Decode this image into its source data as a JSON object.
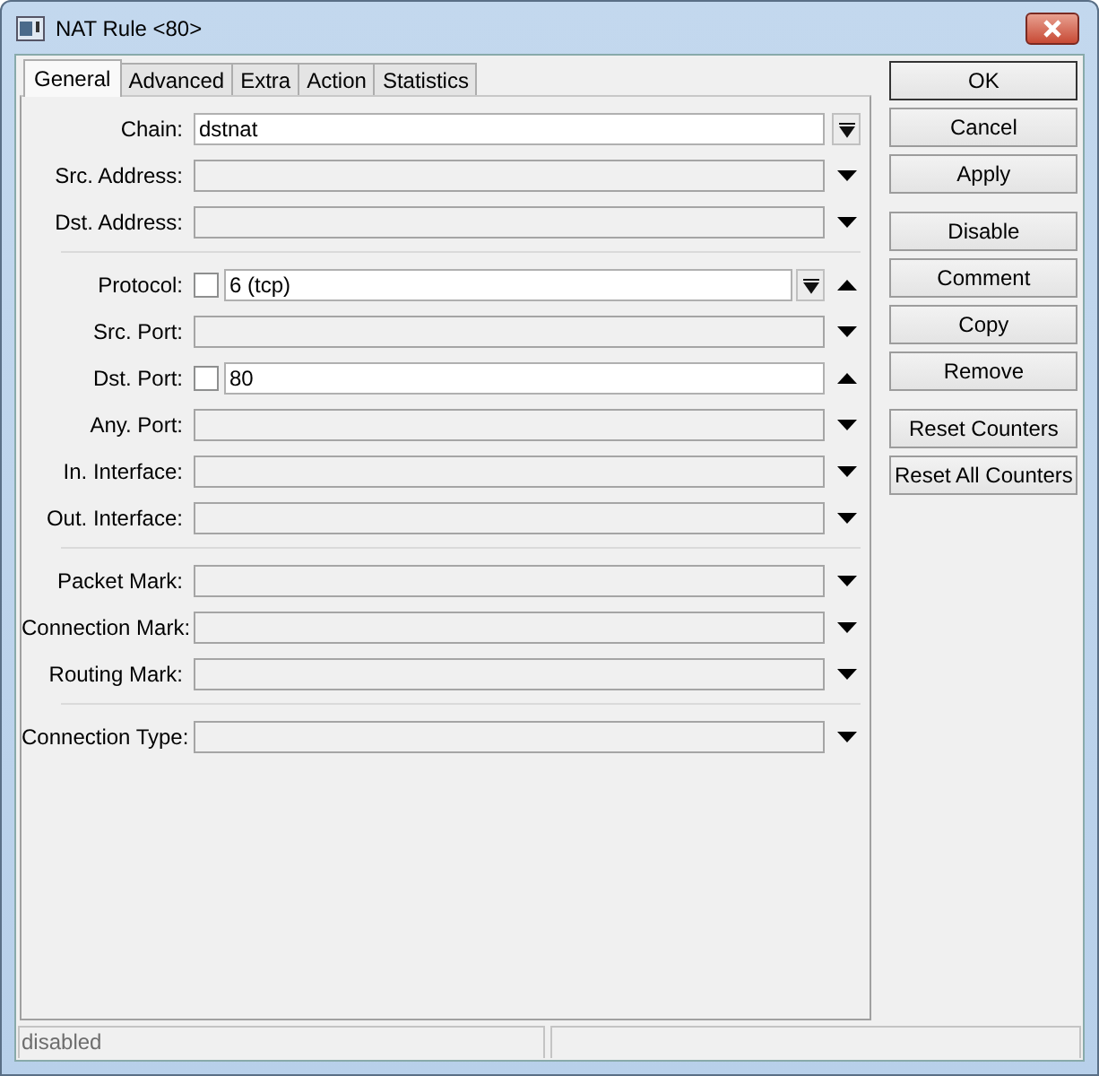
{
  "window": {
    "title": "NAT Rule <80>"
  },
  "tabs": [
    {
      "label": "General",
      "selected": true
    },
    {
      "label": "Advanced",
      "selected": false
    },
    {
      "label": "Extra",
      "selected": false
    },
    {
      "label": "Action",
      "selected": false
    },
    {
      "label": "Statistics",
      "selected": false
    }
  ],
  "groups": [
    {
      "fields": [
        {
          "label": "Chain:",
          "value": "dstnat",
          "kind": "combo"
        },
        {
          "label": "Src. Address:",
          "kind": "dropdown",
          "expanded": false
        },
        {
          "label": "Dst. Address:",
          "kind": "dropdown",
          "expanded": false
        }
      ]
    },
    {
      "fields": [
        {
          "label": "Protocol:",
          "value": "6 (tcp)",
          "kind": "combo",
          "negated": false,
          "expanded": true
        },
        {
          "label": "Src. Port:",
          "kind": "dropdown",
          "expanded": false
        },
        {
          "label": "Dst. Port:",
          "value": "80",
          "kind": "text",
          "negated": false,
          "expanded": true
        },
        {
          "label": "Any. Port:",
          "kind": "dropdown",
          "expanded": false
        },
        {
          "label": "In. Interface:",
          "kind": "dropdown",
          "expanded": false
        },
        {
          "label": "Out. Interface:",
          "kind": "dropdown",
          "expanded": false
        }
      ]
    },
    {
      "fields": [
        {
          "label": "Packet Mark:",
          "kind": "dropdown",
          "expanded": false
        },
        {
          "label": "Connection Mark:",
          "kind": "dropdown",
          "expanded": false
        },
        {
          "label": "Routing Mark:",
          "kind": "dropdown",
          "expanded": false
        }
      ]
    },
    {
      "fields": [
        {
          "label": "Connection Type:",
          "kind": "dropdown",
          "expanded": false
        }
      ]
    }
  ],
  "button_groups": [
    {
      "buttons": [
        {
          "label": "OK",
          "default": true
        },
        {
          "label": "Cancel",
          "default": false
        },
        {
          "label": "Apply",
          "default": false
        }
      ]
    },
    {
      "buttons": [
        {
          "label": "Disable",
          "default": false
        },
        {
          "label": "Comment",
          "default": false
        },
        {
          "label": "Copy",
          "default": false
        },
        {
          "label": "Remove",
          "default": false
        }
      ]
    },
    {
      "buttons": [
        {
          "label": "Reset Counters",
          "default": false
        },
        {
          "label": "Reset All Counters",
          "default": false
        }
      ]
    }
  ],
  "status_bar": [
    "disabled"
  ]
}
